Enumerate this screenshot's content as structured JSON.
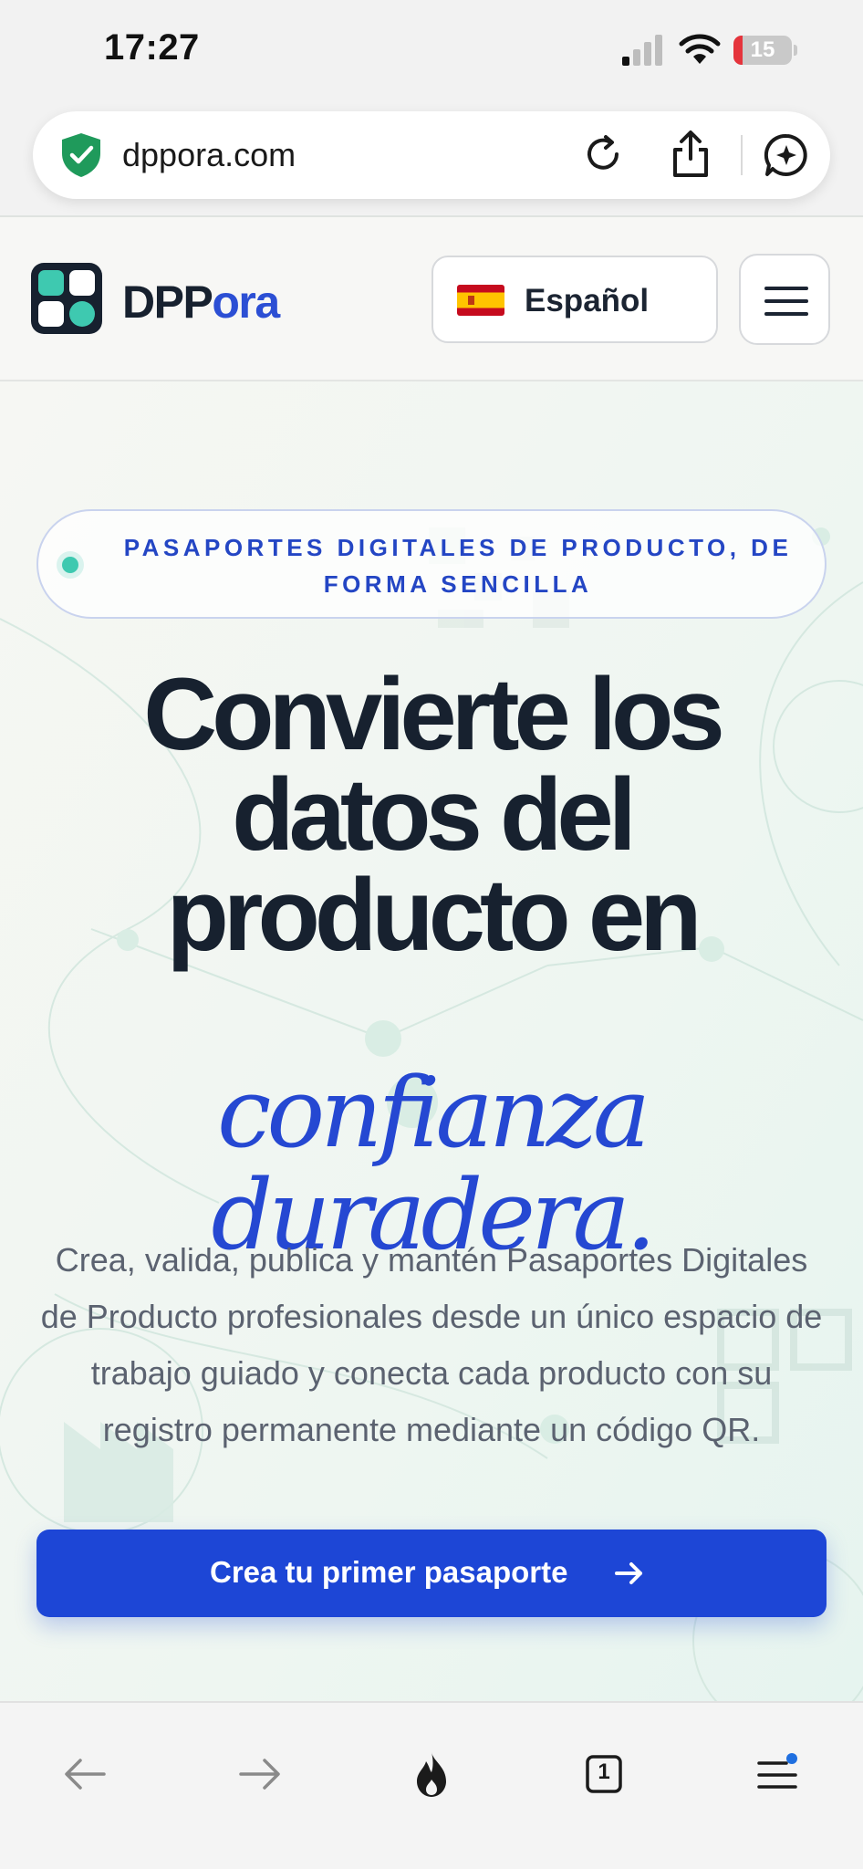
{
  "status_bar": {
    "time": "17:27",
    "battery": "15",
    "battery_level": 0.15
  },
  "browser": {
    "url": "dppora.com"
  },
  "nav": {
    "logo_main": "DPP",
    "logo_accent": "ora",
    "language": "Español"
  },
  "hero": {
    "badge": "PASAPORTES DIGITALES DE PRODUCTO, DE FORMA SENCILLA",
    "headline": "Convierte los datos del producto en",
    "headline_accent": "confianza duradera.",
    "description": "Crea, valida, publica y mantén Pasaportes Digitales de Producto profesionales desde un único espacio de trabajo guiado y conecta cada producto con su registro permanente mediante un código QR.",
    "cta": "Crea tu primer pasaporte"
  },
  "toolbar": {
    "tabs_count": "1"
  },
  "colors": {
    "primary": "#1d46d6",
    "accent_text": "#2548d2",
    "teal": "#3ec9b0",
    "dark": "#17212f"
  }
}
